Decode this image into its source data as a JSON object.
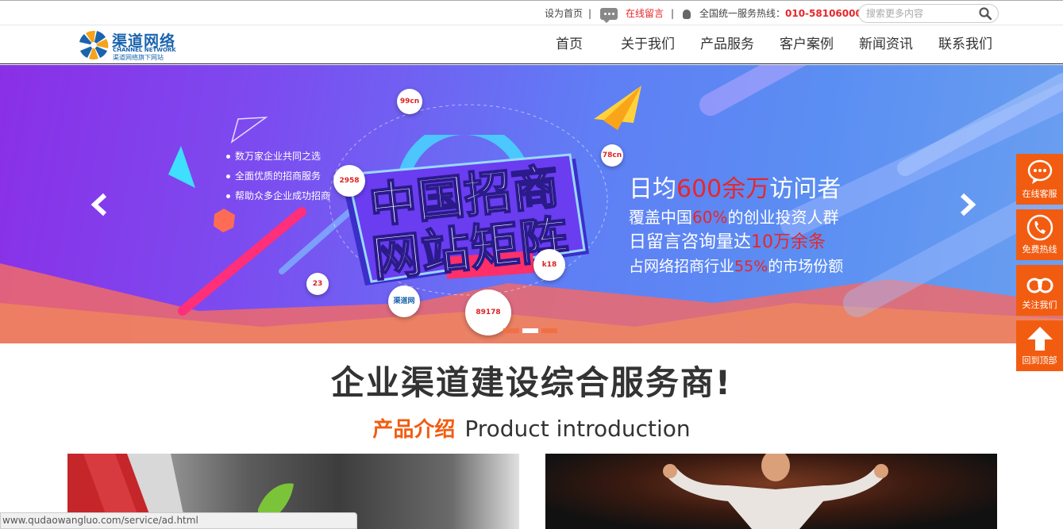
{
  "topbar": {
    "set_home": "设为首页",
    "sep1": "|",
    "online_msg": "在线留言",
    "sep2": "|",
    "hotline_label": "全国统一服务热线：",
    "hotline_number": "010-58106000",
    "search_placeholder": "搜索更多内容"
  },
  "logo": {
    "name_cn": "渠道网络",
    "name_en": "CHANNEL NETWORK",
    "tagline": "渠道网络旗下网站"
  },
  "nav": [
    {
      "label": "首页"
    },
    {
      "label": "关于我们"
    },
    {
      "label": "产品服务"
    },
    {
      "label": "客户案例"
    },
    {
      "label": "新闻资讯"
    },
    {
      "label": "联系我们"
    }
  ],
  "banner": {
    "bullets": [
      "数万家企业共同之选",
      "全面优质的招商服务",
      "帮助众多企业成功招商"
    ],
    "title_line1": "中国招商",
    "title_line2": "网站矩阵",
    "stat1_pre": "日均",
    "stat1_num": "600余万",
    "stat1_post": "访问者",
    "stat2_pre": "覆盖中国",
    "stat2_num": "60%",
    "stat2_post": "的创业投资人群",
    "stat3_pre": "日留言咨询量达",
    "stat3_num": "10万余条",
    "stat4_pre": "占网络招商行业",
    "stat4_num": "55%",
    "stat4_post": "的市场份额",
    "badges": [
      "99cn",
      "2958",
      "78cn",
      "23",
      "k18",
      "渠道网",
      "89178"
    ],
    "active_slide": 2,
    "slide_count": 3
  },
  "side": [
    {
      "label": "在线客服",
      "icon": "chat-bubble-icon"
    },
    {
      "label": "免费热线",
      "icon": "phone-icon"
    },
    {
      "label": "关注我们",
      "icon": "binoculars-icon"
    },
    {
      "label": "回到顶部",
      "icon": "arrow-up-icon"
    }
  ],
  "content": {
    "slogan": "企业渠道建设综合服务商!",
    "section_cn": "产品介绍",
    "section_en": "Product introduction"
  },
  "statusbar": {
    "url": "www.qudaowangluo.com/service/ad.html"
  },
  "colors": {
    "accent": "#f25c11",
    "hotline": "#e8262a",
    "logo_blue": "#1a64ad"
  }
}
